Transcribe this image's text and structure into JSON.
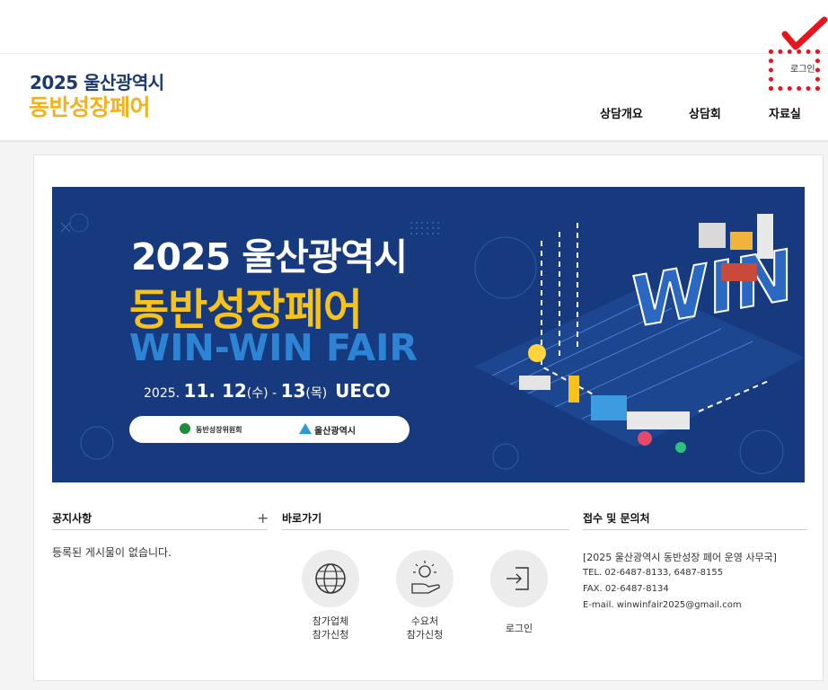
{
  "header": {
    "logo_line1": "2025 울산광역시",
    "logo_line2": "동반성장페어",
    "nav": [
      "상담개요",
      "상담회",
      "자료실"
    ],
    "login": "로그인"
  },
  "banner": {
    "title1": "2025 울산광역시",
    "title2": "동반성장페어",
    "title3": "WIN-WIN FAIR",
    "date_prefix": "2025.",
    "date_main": "11. 12",
    "date_day1": "(수)",
    "date_dash": "-",
    "date_end": "13",
    "date_day2": "(목)",
    "venue": "UECO",
    "org1": "동반성장위원회",
    "org2": "울산광역시",
    "art_word": "WIN"
  },
  "notice": {
    "title": "공지사항",
    "plus": "+",
    "empty": "등록된 게시물이 없습니다."
  },
  "quicklinks": {
    "title": "바로가기",
    "items": [
      {
        "line1": "참가업체",
        "line2": "참가신청",
        "icon": "globe-icon"
      },
      {
        "line1": "수요처",
        "line2": "참가신청",
        "icon": "idea-hand-icon"
      },
      {
        "line1": "로그인",
        "line2": "",
        "icon": "login-icon"
      }
    ]
  },
  "contact": {
    "title": "접수 및 문의처",
    "org": "[2025 울산광역시 동반성장 페어 운영 사무국]",
    "tel": "TEL. 02-6487-8133, 6487-8155",
    "fax": "FAX. 02-6487-8134",
    "email": "E-mail. winwinfair2025@gmail.com"
  },
  "colors": {
    "brand_navy": "#1b3a6b",
    "brand_yellow": "#f3b21b",
    "banner_bg": "#173a7e",
    "highlight_red": "#e8141c"
  }
}
